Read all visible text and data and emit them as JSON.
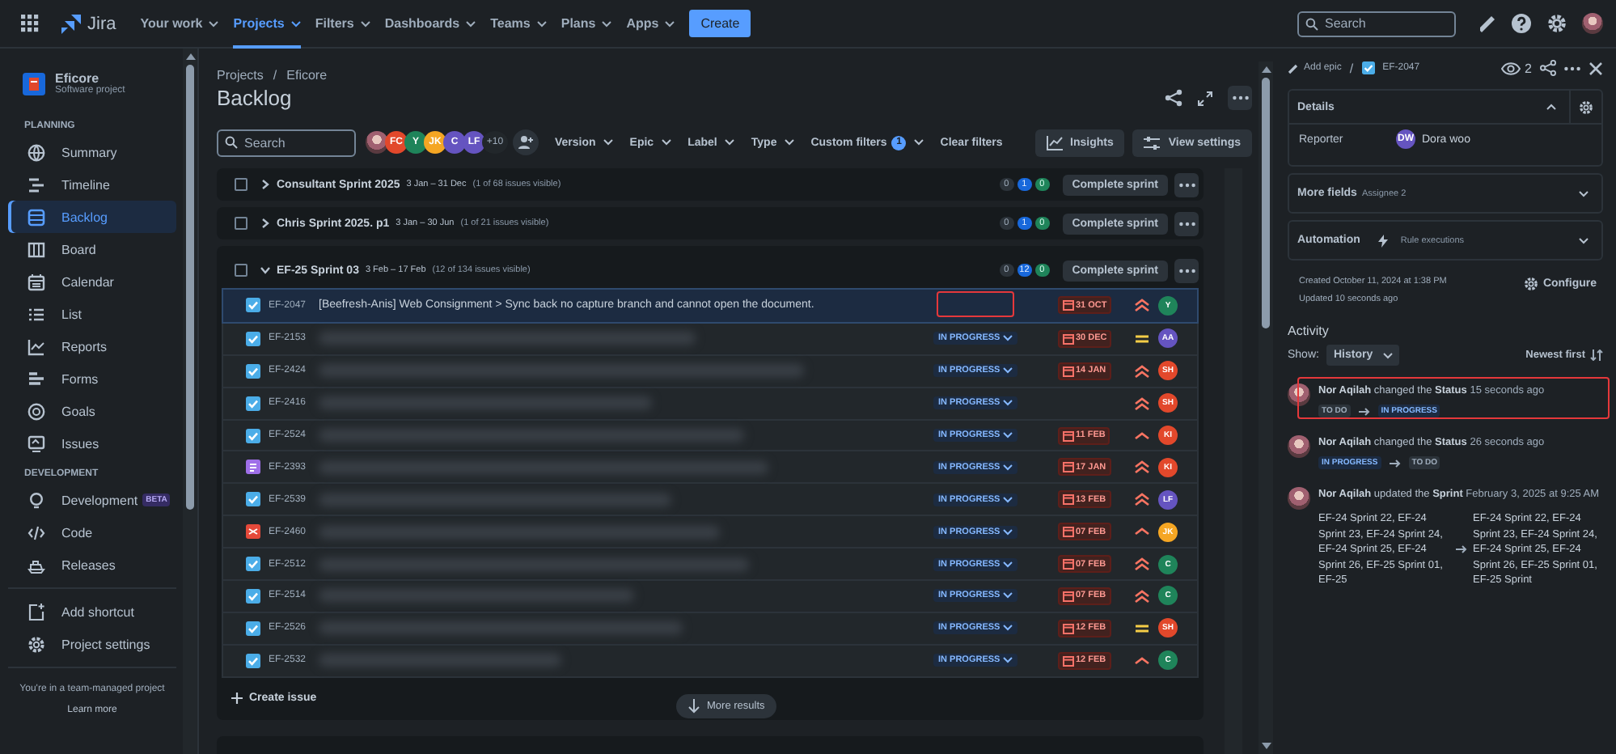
{
  "nav": {
    "product": "Jira",
    "items": [
      {
        "label": "Your work",
        "selected": false
      },
      {
        "label": "Projects",
        "selected": true
      },
      {
        "label": "Filters",
        "selected": false
      },
      {
        "label": "Dashboards",
        "selected": false
      },
      {
        "label": "Teams",
        "selected": false
      },
      {
        "label": "Plans",
        "selected": false
      },
      {
        "label": "Apps",
        "selected": false
      }
    ],
    "create": "Create",
    "search": {
      "placeholder": "Search"
    }
  },
  "sidebar": {
    "project": {
      "name": "Eficore",
      "type": "Software project"
    },
    "sections": [
      {
        "title": "PLANNING",
        "items": [
          {
            "label": "Summary",
            "selected": false
          },
          {
            "label": "Timeline",
            "selected": false
          },
          {
            "label": "Backlog",
            "selected": true
          },
          {
            "label": "Board",
            "selected": false
          },
          {
            "label": "Calendar",
            "selected": false
          },
          {
            "label": "List",
            "selected": false
          },
          {
            "label": "Reports",
            "selected": false
          },
          {
            "label": "Forms",
            "selected": false
          },
          {
            "label": "Goals",
            "selected": false
          },
          {
            "label": "Issues",
            "selected": false
          }
        ]
      },
      {
        "title": "DEVELOPMENT",
        "items": [
          {
            "label": "Development",
            "selected": false,
            "badge": "BETA"
          },
          {
            "label": "Code",
            "selected": false
          },
          {
            "label": "Releases",
            "selected": false
          }
        ]
      }
    ],
    "extras": [
      {
        "label": "Add shortcut"
      },
      {
        "label": "Project settings"
      }
    ],
    "footer": {
      "text": "You're in a team-managed project",
      "link": "Learn more"
    }
  },
  "page": {
    "breadcrumb": [
      "Projects",
      "Eficore"
    ],
    "separator": "/",
    "title": "Backlog",
    "search": {
      "placeholder": "Search"
    },
    "avatars": [
      {
        "photo": true
      },
      {
        "initials": "FC",
        "color": "#e2482b"
      },
      {
        "initials": "Y",
        "color": "#1f845a"
      },
      {
        "initials": "JK",
        "color": "#f5a623"
      },
      {
        "initials": "C",
        "color": "#6554c0"
      },
      {
        "initials": "LF",
        "color": "#6554c0"
      }
    ],
    "more_avatars": "+10",
    "filters": [
      {
        "label": "Version"
      },
      {
        "label": "Epic"
      },
      {
        "label": "Label"
      },
      {
        "label": "Type"
      },
      {
        "label": "Custom filters",
        "count": "1"
      }
    ],
    "clear": "Clear filters",
    "insights": "Insights",
    "view_settings": "View settings"
  },
  "sprints": [
    {
      "name": "Consultant Sprint 2025",
      "dates": "3 Jan – 31 Dec",
      "visible": "(1 of 68 issues visible)",
      "checked": false,
      "expanded": false,
      "counts": [
        "0",
        "1",
        "0"
      ],
      "action": "Complete sprint"
    },
    {
      "name": "Chris Sprint 2025. p1",
      "dates": "3 Jan – 30 Jun",
      "visible": "(1 of 21 issues visible)",
      "checked": false,
      "expanded": false,
      "counts": [
        "0",
        "1",
        "0"
      ],
      "action": "Complete sprint"
    },
    {
      "name": "EF-25 Sprint 03",
      "dates": "3 Feb – 17 Feb",
      "visible": "(12 of 134 issues visible)",
      "checked": false,
      "expanded": true,
      "counts": [
        "0",
        "12",
        "0"
      ],
      "action": "Complete sprint",
      "issues": [
        {
          "key": "EF-2047",
          "kind": "task",
          "summary": "[Beefresh-Anis] Web Consignment > Sync back no capture branch and cannot open the document.",
          "due": "31 OCT",
          "priority": {
            "kind": "highest"
          },
          "assignee": "Y",
          "color": "#1f845a",
          "selected": true,
          "highlighted": true
        },
        {
          "key": "EF-2153",
          "kind": "task",
          "status": "IN PROGRESS",
          "due": "30 DEC",
          "priority": {
            "kind": "medium"
          },
          "assignee": "AA",
          "color": "#6554c0",
          "selected": false,
          "highlighted": false
        },
        {
          "key": "EF-2424",
          "kind": "task",
          "status": "IN PROGRESS",
          "due": "14 JAN",
          "priority": {
            "kind": "highest"
          },
          "assignee": "SH",
          "color": "#e2482b",
          "selected": false,
          "highlighted": false
        },
        {
          "key": "EF-2416",
          "kind": "task",
          "status": "IN PROGRESS",
          "priority": {
            "kind": "highest"
          },
          "assignee": "SH",
          "color": "#e2482b",
          "selected": false,
          "highlighted": false
        },
        {
          "key": "EF-2524",
          "kind": "task",
          "status": "IN PROGRESS",
          "due": "11 FEB",
          "priority": {
            "kind": "high"
          },
          "assignee": "KI",
          "color": "#e2482b",
          "selected": false,
          "highlighted": false
        },
        {
          "key": "EF-2393",
          "kind": "story",
          "status": "IN PROGRESS",
          "due": "17 JAN",
          "priority": {
            "kind": "highest"
          },
          "assignee": "KI",
          "color": "#e2482b",
          "selected": false,
          "highlighted": false
        },
        {
          "key": "EF-2539",
          "kind": "task",
          "status": "IN PROGRESS",
          "due": "13 FEB",
          "priority": {
            "kind": "highest"
          },
          "assignee": "LF",
          "color": "#6554c0",
          "selected": false,
          "highlighted": false
        },
        {
          "key": "EF-2460",
          "kind": "bug",
          "status": "IN PROGRESS",
          "due": "07 FEB",
          "priority": {
            "kind": "high"
          },
          "assignee": "JK",
          "color": "#f5a623",
          "selected": false,
          "highlighted": false
        },
        {
          "key": "EF-2512",
          "kind": "task",
          "status": "IN PROGRESS",
          "due": "07 FEB",
          "priority": {
            "kind": "highest"
          },
          "assignee": "C",
          "color": "#1f845a",
          "selected": false,
          "highlighted": false
        },
        {
          "key": "EF-2514",
          "kind": "task",
          "status": "IN PROGRESS",
          "due": "07 FEB",
          "priority": {
            "kind": "highest"
          },
          "assignee": "C",
          "color": "#1f845a",
          "selected": false,
          "highlighted": false
        },
        {
          "key": "EF-2526",
          "kind": "task",
          "status": "IN PROGRESS",
          "due": "12 FEB",
          "priority": {
            "kind": "medium"
          },
          "assignee": "SH",
          "color": "#e2482b",
          "selected": false,
          "highlighted": false
        },
        {
          "key": "EF-2532",
          "kind": "task",
          "status": "IN PROGRESS",
          "due": "12 FEB",
          "priority": {
            "kind": "high"
          },
          "assignee": "C",
          "color": "#1f845a",
          "selected": false,
          "highlighted": false
        }
      ],
      "create_issue": "Create issue",
      "more_results": "More results"
    }
  ],
  "detail": {
    "add_epic": "Add epic",
    "separator": "/",
    "key": "EF-2047",
    "watchers": "2",
    "details": {
      "title": "Details",
      "expanded": true,
      "reporter_label": "Reporter",
      "reporter": "Dora woo",
      "reporter_initials": "DW"
    },
    "more_fields": {
      "title": "More fields",
      "hint": "Assignee 2"
    },
    "automation": {
      "title": "Automation",
      "hint": "Rule executions"
    },
    "created": "Created October 11, 2024 at 1:38 PM",
    "updated": "Updated 10 seconds ago",
    "configure": "Configure",
    "activity": {
      "title": "Activity",
      "show_label": "Show:",
      "show": "History",
      "sort": "Newest first",
      "entries": [
        {
          "kind": "status",
          "author": "Nor Aqilah",
          "action": "changed the",
          "field": "Status",
          "time": "15 seconds ago",
          "from": {
            "label": "TO DO",
            "kind": "todo"
          },
          "to": {
            "label": "IN PROGRESS",
            "kind": "progress"
          },
          "highlighted": true
        },
        {
          "kind": "status",
          "author": "Nor Aqilah",
          "action": "changed the",
          "field": "Status",
          "time": "26 seconds ago",
          "from": {
            "label": "IN PROGRESS",
            "kind": "progress"
          },
          "to": {
            "label": "TO DO",
            "kind": "todo"
          },
          "highlighted": false
        },
        {
          "kind": "text",
          "author": "Nor Aqilah",
          "action": "updated the",
          "field": "Sprint",
          "time": "February 3, 2025 at 9:25 AM",
          "from": {
            "label": "EF-24 Sprint 22, EF-24 Sprint 23, EF-24 Sprint 24, EF-24 Sprint 25, EF-24 Sprint 26, EF-25 Sprint 01, EF-25"
          },
          "to": {
            "label": "EF-24 Sprint 22, EF-24 Sprint 23, EF-24 Sprint 24, EF-24 Sprint 25, EF-24 Sprint 26, EF-25 Sprint 01, EF-25 Sprint"
          },
          "highlighted": false
        }
      ]
    }
  }
}
